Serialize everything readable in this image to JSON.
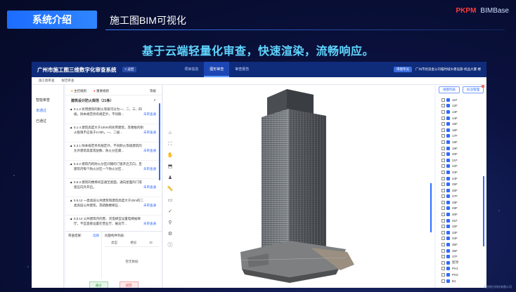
{
  "slide": {
    "section": "系统介绍",
    "title": "施工图BIM可视化",
    "headline": "基于云端轻量化审查，快速渲染，流畅响应。",
    "brand_mark": "PKPM",
    "brand_product": "BIMBase",
    "watermark": "北京构力科技有限公司"
  },
  "app": {
    "name": "广州市施工图三维数字化审查系统",
    "back": "< 返回",
    "tabs": [
      {
        "label": "项目信息"
      },
      {
        "label": "图形审查"
      },
      {
        "label": "审查报告"
      }
    ],
    "top_tag": "审图专员",
    "project": "广州市优良金公司临时城乡建设部-机品大厦-楼",
    "breadcrumb": [
      "施工图审查",
      "规范审查"
    ]
  },
  "left_nav": [
    {
      "label": "智能审查"
    },
    {
      "label": "未通过"
    },
    {
      "label": "已通过"
    }
  ],
  "rule_panel": {
    "filter_a": "主控规则",
    "filter_b": "重要规则",
    "header_right": "等级",
    "group_title": "建筑设计防火规范（21条）",
    "group_toggle": "∨",
    "link_label": "未审查通",
    "rules": [
      {
        "text": "5.1.2 民用建筑的耐火等级可分为一、二、三、四级。除本规范另有规定外，不同耐..."
      },
      {
        "text": "5.1.4 建筑高度大于100m的民用建筑，其楼板的耐火极限不应低于2.00h。一、二级..."
      },
      {
        "text": "5.3.1 除本规范另有规定外，不同耐火等级建筑的允许建筑高度或层数、防火分区最..."
      },
      {
        "text": "5.3.2 建筑内的防火分区间隔的门窗开启方向，且建筑内每个防火分区一个防火分区..."
      },
      {
        "text": "5.5.3 建筑的楼梯间宜通至屋面，通向屋面的门或窗应向外开启。"
      },
      {
        "text": "5.5.12 一类高层公共建筑和建筑高度大于32m的二类高层公共建筑，其疏散楼梯应..."
      },
      {
        "text": "5.5.14 公共建筑内的客、货电梯宜设置电梯候梯厅，不宜直接设置在营业厅、展览厅..."
      },
      {
        "text": "5.5.15 公共建筑内房间的疏散门数量应经计算确定且不应少于2个，除托儿所、幼儿..."
      },
      {
        "text": "5.5.17 公共建筑的安全疏散距离应符合下列规定..."
      }
    ]
  },
  "opinion": {
    "label": "审查结果:",
    "select": "选择",
    "problems_label": "问题构件列表:",
    "cols": [
      "类型",
      "楼层",
      "ID"
    ],
    "empty": "暂无数据",
    "pass": "通过",
    "reject": "驳回"
  },
  "toolbar": [
    {
      "name": "home-icon",
      "glyph": "⌂"
    },
    {
      "name": "fit-view-icon",
      "glyph": "⛶"
    },
    {
      "name": "pan-hand-icon",
      "glyph": "✋"
    },
    {
      "name": "section-box-icon",
      "glyph": "⬒"
    },
    {
      "name": "person-walk-icon",
      "glyph": "♟"
    },
    {
      "name": "measure-icon",
      "glyph": "📏"
    },
    {
      "name": "clip-plane-icon",
      "glyph": "▭"
    },
    {
      "name": "check-icon",
      "glyph": "✓"
    },
    {
      "name": "search-icon",
      "glyph": "⚲"
    },
    {
      "name": "settings-icon",
      "glyph": "⚙"
    },
    {
      "name": "info-icon",
      "glyph": "ⓘ"
    }
  ],
  "floor_panel": {
    "view_btn": "视图列表",
    "review_btn": "标注管理",
    "review_badge": "1",
    "floors": [
      "11F",
      "12F",
      "13F",
      "14F",
      "15F",
      "16F",
      "17F",
      "18F",
      "19F",
      "20F",
      "21F",
      "22F",
      "23F",
      "24F",
      "25F",
      "26F",
      "27F",
      "28F",
      "29F",
      "30F",
      "31F",
      "32F",
      "33F",
      "34F",
      "35F",
      "36F",
      "37F",
      "屋顶",
      "PH1",
      "PH2",
      "B1"
    ]
  },
  "colors": {
    "app_header": "#0f2c7a",
    "accent": "#2f6bff",
    "headline": "#5fd6ff"
  }
}
